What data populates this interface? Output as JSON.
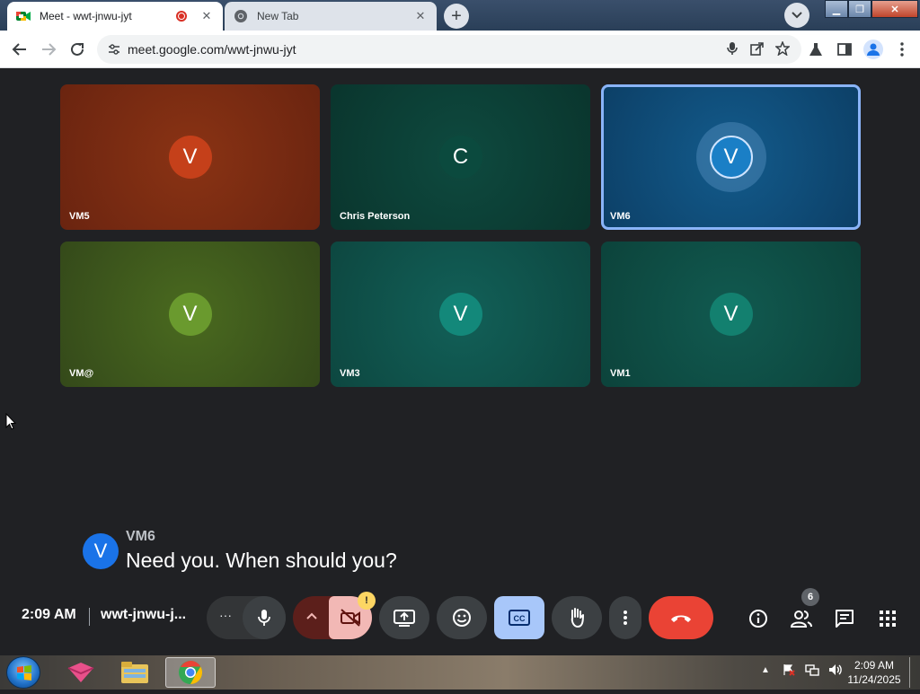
{
  "browser": {
    "tabs": [
      {
        "title": "Meet - wwt-jnwu-jyt",
        "active": true
      },
      {
        "title": "New Tab",
        "active": false
      }
    ],
    "url": "meet.google.com/wwt-jnwu-jyt",
    "colors": {
      "titlebar": "#2a3f58",
      "tab_active": "#ffffff",
      "tab_inactive": "#dee3ea"
    }
  },
  "meet": {
    "tiles": [
      {
        "initial": "V",
        "name": "VM5",
        "bg": "#7a2a10",
        "avatar_bg": "#c5401a"
      },
      {
        "initial": "C",
        "name": "Chris Peterson",
        "bg": "#0d3f36",
        "avatar_bg": "#0b4a3e"
      },
      {
        "initial": "V",
        "name": "VM6",
        "bg": "#0f4d7a",
        "avatar_bg": "#1a7fc6",
        "speaking": true
      },
      {
        "initial": "V",
        "name": "VM@",
        "bg": "#3f5a1a",
        "avatar_bg": "#6a9a2e"
      },
      {
        "initial": "V",
        "name": "VM3",
        "bg": "#0f524a",
        "avatar_bg": "#13887a"
      },
      {
        "initial": "V",
        "name": "VM1",
        "bg": "#0f4d44",
        "avatar_bg": "#13806f"
      }
    ],
    "caption": {
      "initial": "V",
      "speaker": "VM6",
      "text": "Need you. When should you?"
    },
    "bottom_bar": {
      "time": "2:09 AM",
      "meeting_code": "wwt-jnwu-j...",
      "participants_count": "6",
      "camera_warning": "!"
    },
    "colors": {
      "background": "#202124",
      "end_call": "#ea4335",
      "captions_active": "#a8c7fa",
      "camera_off": "#f2b8b5",
      "speaking_outline": "#8ab4f8"
    }
  },
  "taskbar": {
    "time": "2:09 AM",
    "date": "11/24/2025"
  }
}
